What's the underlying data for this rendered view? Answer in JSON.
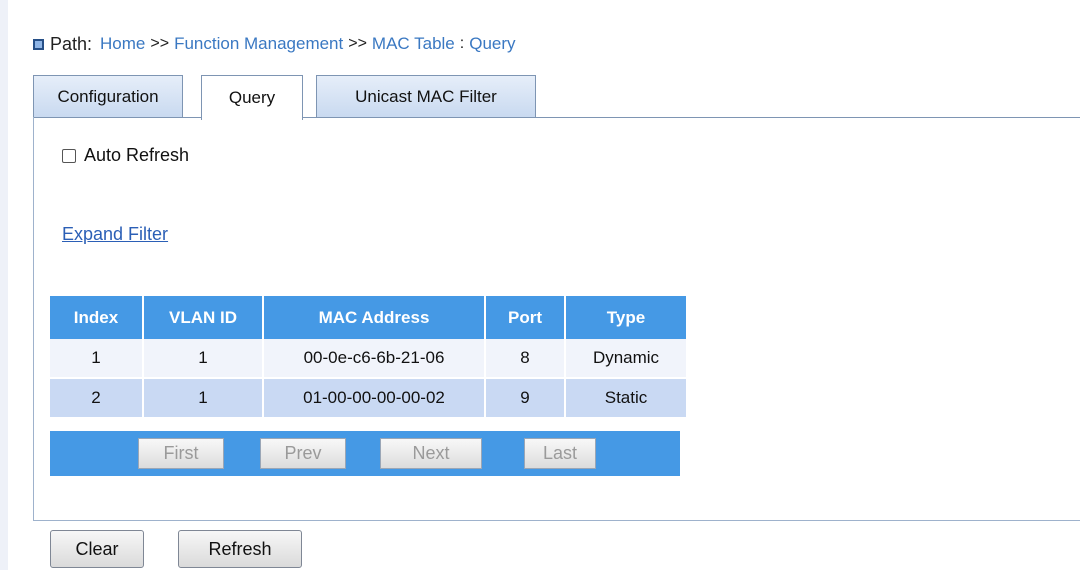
{
  "breadcrumb": {
    "label": "Path:",
    "items": [
      "Home",
      "Function Management",
      "MAC Table"
    ],
    "separator": ">>",
    "current": "Query"
  },
  "tabs": [
    {
      "label": "Configuration",
      "active": false
    },
    {
      "label": "Query",
      "active": true
    },
    {
      "label": "Unicast MAC Filter",
      "active": false
    }
  ],
  "auto_refresh": {
    "label": "Auto Refresh",
    "checked": false
  },
  "expand_filter": "Expand Filter",
  "table": {
    "headers": [
      "Index",
      "VLAN ID",
      "MAC Address",
      "Port",
      "Type"
    ],
    "rows": [
      [
        "1",
        "1",
        "00-0e-c6-6b-21-06",
        "8",
        "Dynamic"
      ],
      [
        "2",
        "1",
        "01-00-00-00-00-02",
        "9",
        "Static"
      ]
    ]
  },
  "pager": {
    "first": "First",
    "prev": "Prev",
    "next": "Next",
    "last": "Last"
  },
  "buttons": {
    "clear": "Clear",
    "refresh": "Refresh"
  },
  "colors": {
    "table_header": "#4599e5",
    "link": "#3a78c2",
    "row_alt": "#c9d9f3"
  }
}
